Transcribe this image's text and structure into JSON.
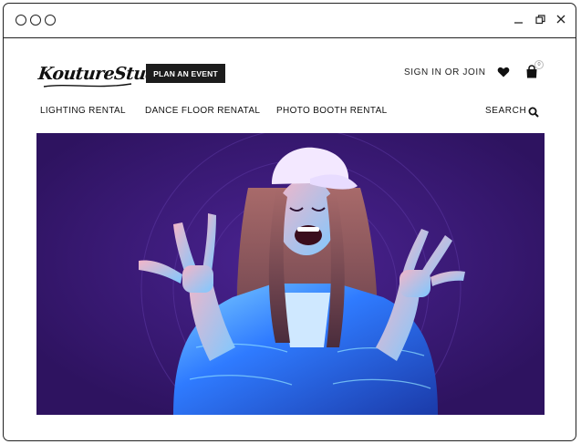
{
  "window": {
    "controls": [
      "minimize-icon",
      "restore-icon",
      "close-icon"
    ]
  },
  "brand": {
    "logo_text": "KoutureStudios"
  },
  "header": {
    "cta_label": "PLAN AN EVENT",
    "signin_label": "SIGN IN OR JOIN",
    "wishlist_icon": "heart-icon",
    "cart_icon": "shopping-bag-icon",
    "cart_count": "0"
  },
  "nav": {
    "items": [
      {
        "label": "LIGHTING RENTAL"
      },
      {
        "label": "DANCE FLOOR RENATAL"
      },
      {
        "label": "PHOTO BOOTH RENTAL"
      }
    ],
    "search_label": "SEARCH",
    "search_icon": "search-icon"
  },
  "hero": {
    "background_color": "#321563",
    "accent_color": "#2f7bff"
  }
}
